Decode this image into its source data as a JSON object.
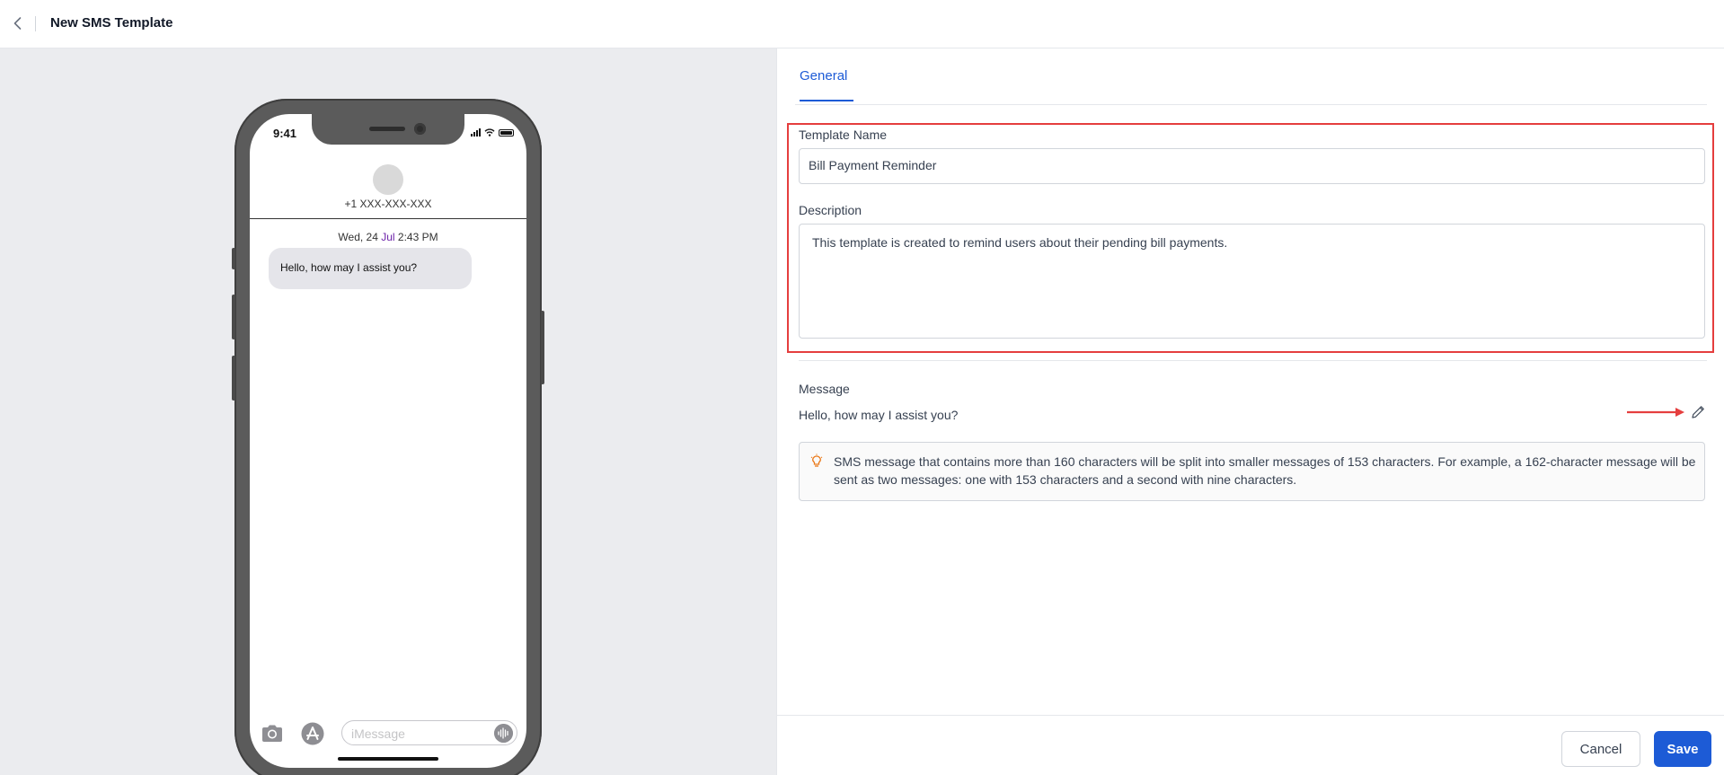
{
  "header": {
    "title": "New SMS Template"
  },
  "preview": {
    "status_time": "9:41",
    "contact_number": "+1 XXX-XXX-XXX",
    "date_prefix": "Wed, 24 ",
    "date_month": "Jul",
    "date_suffix": " 2:43 PM",
    "bubble_text": "Hello, how may I assist you?",
    "composer_placeholder": "iMessage"
  },
  "tabs": {
    "general": "General"
  },
  "form": {
    "template_name_label": "Template Name",
    "template_name_value": "Bill Payment Reminder",
    "description_label": "Description",
    "description_value": "This template is created to remind users about their pending bill payments.",
    "message_label": "Message",
    "message_value": "Hello, how may I assist you?",
    "info_text": "SMS message that contains more than 160 characters will be split into smaller messages of 153 characters. For example, a 162-character message will be sent as two messages: one with 153 characters and a second with nine characters."
  },
  "footer": {
    "cancel_label": "Cancel",
    "save_label": "Save"
  },
  "colors": {
    "accent": "#1d5bd6",
    "highlight": "#e53e3e",
    "preview_background": "#ebecef"
  },
  "icons": [
    "chevron-left-icon",
    "camera-icon",
    "app-store-icon",
    "audio-wave-icon",
    "pencil-icon",
    "lightbulb-icon",
    "arrow-right-icon",
    "signal-icon",
    "wifi-icon",
    "battery-icon"
  ]
}
